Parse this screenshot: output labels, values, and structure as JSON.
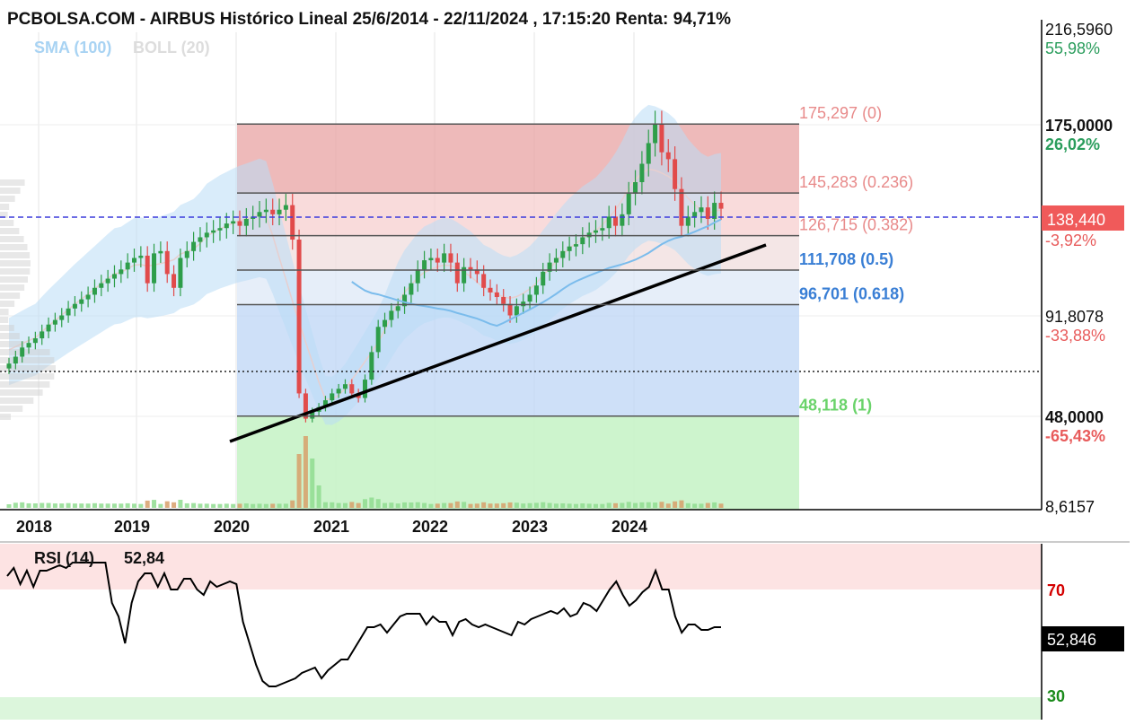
{
  "header": {
    "title": "PCBOLSA.COM - AIRBUS Histórico Lineal 25/6/2014 - 22/11/2024 , 17:15:20 Renta: 94,71%"
  },
  "indicators": {
    "sma": "SMA (100)",
    "boll": "BOLL (20)"
  },
  "colors": {
    "up_candle": "#2e9e4a",
    "down_candle": "#e14b4b",
    "fib_red": "#e8a3a3",
    "fib_pink": "#f7cfcf",
    "fib_blue": "#bdd6f5",
    "fib_green": "#c8f3c8",
    "boll_band": "#b9dcf5",
    "current_price_line": "#3b3bdc",
    "pct_up": "#2a9d5c",
    "pct_down": "#e85b5b",
    "rsi_line": "#000000",
    "fib_label_red": "#e88a8a",
    "fib_label_blue": "#3a7fd5",
    "fib_label_green": "#6ad36a"
  },
  "price_axis": {
    "labels": [
      {
        "price": "216,5960",
        "pct": "55,98%",
        "pct_dir": "up"
      },
      {
        "price": "175,0000",
        "pct": "26,02%",
        "pct_dir": "up",
        "bold": true
      },
      {
        "price": "91,8078",
        "pct": "-33,88%",
        "pct_dir": "down"
      },
      {
        "price": "48,0000",
        "pct": "-65,43%",
        "pct_dir": "down",
        "bold": true
      },
      {
        "price": "8,6157",
        "pct": "",
        "pct_dir": ""
      }
    ],
    "current_price": "138,440",
    "current_pct": "-3,92%"
  },
  "fibonacci": [
    {
      "level": "0",
      "price": 175.297,
      "label": "175,297 (0)"
    },
    {
      "level": "0.236",
      "price": 145.283,
      "label": "145,283 (0.236)"
    },
    {
      "level": "0.382",
      "price": 126.715,
      "label": "126,715 (0.382)"
    },
    {
      "level": "0.5",
      "price": 111.708,
      "label": "111,708 (0.5)"
    },
    {
      "level": "0.618",
      "price": 96.701,
      "label": "96,701 (0.618)"
    },
    {
      "level": "1",
      "price": 48.118,
      "label": "48,118 (1)"
    }
  ],
  "x_axis": {
    "labels": [
      "2018",
      "2019",
      "2020",
      "2021",
      "2022",
      "2023",
      "2024"
    ]
  },
  "rsi": {
    "label": "RSI (14)",
    "value": "52,84",
    "current": "52,846",
    "levels": [
      "70",
      "30"
    ]
  },
  "chart_data": [
    {
      "type": "candlestick",
      "title": "PCBOLSA.COM - AIRBUS Histórico Lineal 25/6/2014 - 22/11/2024 , 17:15:20 Renta: 94,71%",
      "x_ticks": [
        "2018",
        "2019",
        "2020",
        "2021",
        "2022",
        "2023",
        "2024"
      ],
      "y_ticks": [
        "216,5960",
        "175,0000",
        "91,8078",
        "48,0000",
        "8,6157"
      ],
      "ylim": [
        8.6,
        216.6
      ],
      "current_price": 138.44,
      "series": [
        {
          "name": "SMA (100)"
        },
        {
          "name": "BOLL (20)"
        }
      ],
      "fibonacci_retracement": [
        175.297,
        145.283,
        126.715,
        111.708,
        96.701,
        48.118
      ],
      "close": [
        71,
        74,
        78,
        80,
        82,
        85,
        88,
        90,
        92,
        95,
        97,
        99,
        101,
        104,
        106,
        108,
        110,
        112,
        115,
        117,
        118,
        106,
        119,
        120,
        110,
        104,
        117,
        120,
        124,
        126,
        128,
        129,
        130,
        132,
        133,
        131,
        134,
        135,
        137,
        138,
        136,
        138,
        140,
        125,
        58,
        47,
        50,
        52,
        55,
        58,
        60,
        62,
        58,
        56,
        64,
        76,
        87,
        90,
        94,
        96,
        101,
        106,
        112,
        116,
        117,
        115,
        119,
        115,
        106,
        113,
        112,
        110,
        104,
        102,
        100,
        97,
        92,
        96,
        98,
        101,
        105,
        111,
        115,
        117,
        120,
        122,
        123,
        126,
        128,
        129,
        130,
        135,
        131,
        136,
        145,
        150,
        158,
        167,
        175,
        163,
        160,
        147,
        131,
        135,
        137,
        139,
        134,
        141,
        138.44
      ],
      "volume_shown": true
    },
    {
      "type": "line",
      "title": "RSI (14)",
      "ylim": [
        0,
        100
      ],
      "x_ticks": [
        "2018",
        "2019",
        "2020",
        "2021",
        "2022",
        "2023",
        "2024"
      ],
      "y_ticks": [
        "70",
        "30"
      ],
      "overbought": 70,
      "oversold": 30,
      "current_value": 52.846,
      "series": [
        {
          "name": "RSI (14)",
          "values": [
            75,
            78,
            72,
            77,
            71,
            77,
            77,
            78,
            79,
            78,
            80,
            80,
            80,
            80,
            80,
            80,
            65,
            60,
            50,
            65,
            73,
            76,
            76,
            71,
            76,
            70,
            70,
            74,
            74,
            70,
            68,
            73,
            71,
            72,
            73,
            72,
            58,
            50,
            42,
            36,
            34,
            34,
            35,
            36,
            37,
            39,
            40,
            41,
            37,
            40,
            42,
            44,
            44,
            48,
            52,
            56,
            56,
            57,
            54,
            57,
            60,
            61,
            61,
            61,
            57,
            60,
            58,
            58,
            53,
            58,
            59,
            57,
            56,
            57,
            56,
            55,
            54,
            53,
            58,
            57,
            59,
            60,
            61,
            62,
            61,
            63,
            60,
            61,
            65,
            64,
            62,
            66,
            70,
            73,
            68,
            64,
            66,
            69,
            71,
            77,
            70,
            70,
            60,
            54,
            57,
            57,
            55,
            55,
            56,
            56
          ]
        }
      ]
    }
  ]
}
